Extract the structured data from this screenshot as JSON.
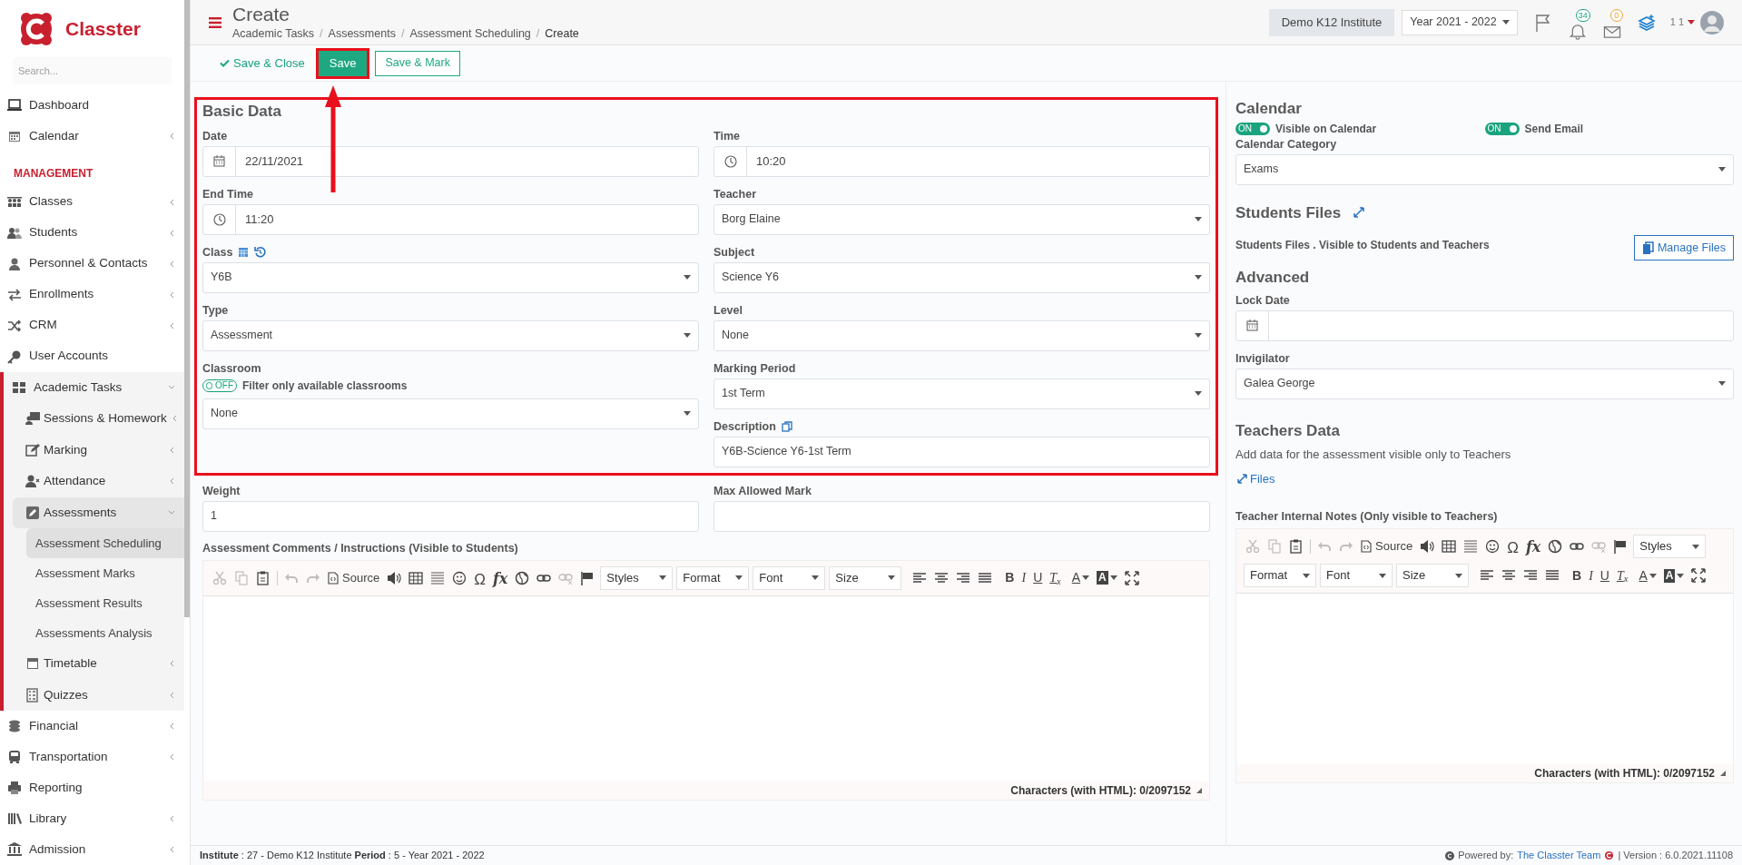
{
  "sidebar": {
    "brand": "Classter",
    "search": {
      "placeholder": "Search..."
    },
    "items": [
      {
        "kind": "link",
        "label": "Dashboard",
        "selected": false
      },
      {
        "kind": "group",
        "label": "Calendar",
        "expanded": false,
        "selected": false
      },
      {
        "kind": "heading",
        "label": "MANAGEMENT"
      },
      {
        "kind": "group",
        "label": "Classes",
        "expanded": false,
        "selected": false
      },
      {
        "kind": "group",
        "label": "Students",
        "expanded": false,
        "selected": false
      },
      {
        "kind": "group",
        "label": "Personnel & Contacts",
        "expanded": false,
        "selected": false
      },
      {
        "kind": "group",
        "label": "Enrollments",
        "expanded": false,
        "selected": false
      },
      {
        "kind": "group",
        "label": "CRM",
        "expanded": false,
        "selected": false
      },
      {
        "kind": "link",
        "label": "User Accounts",
        "selected": false
      },
      {
        "kind": "group",
        "label": "Academic Tasks",
        "expanded": true,
        "selected": false,
        "children": [
          {
            "kind": "group",
            "label": "Sessions & Homework",
            "expanded": false,
            "selected": false
          },
          {
            "kind": "group",
            "label": "Marking",
            "expanded": false,
            "selected": false
          },
          {
            "kind": "group",
            "label": "Attendance",
            "expanded": false,
            "selected": false
          },
          {
            "kind": "group",
            "label": "Assessments",
            "expanded": true,
            "selected": false,
            "children": [
              {
                "label": "Assessment Scheduling",
                "selected": true
              },
              {
                "label": "Assessment Marks",
                "selected": false
              },
              {
                "label": "Assessment Results",
                "selected": false
              },
              {
                "label": "Assessments Analysis",
                "selected": false
              }
            ]
          },
          {
            "kind": "group",
            "label": "Timetable",
            "expanded": false,
            "selected": false
          },
          {
            "kind": "group",
            "label": "Quizzes",
            "expanded": false,
            "selected": false
          }
        ]
      },
      {
        "kind": "group",
        "label": "Financial",
        "expanded": false,
        "selected": false
      },
      {
        "kind": "group",
        "label": "Transportation",
        "expanded": false,
        "selected": false
      },
      {
        "kind": "link",
        "label": "Reporting",
        "selected": false
      },
      {
        "kind": "group",
        "label": "Library",
        "expanded": false,
        "selected": false
      },
      {
        "kind": "group",
        "label": "Admission",
        "expanded": false,
        "selected": false
      }
    ]
  },
  "header": {
    "title": "Create",
    "breadcrumbs": [
      {
        "kind": "link",
        "label": "Academic Tasks"
      },
      {
        "kind": "separator",
        "label": "/"
      },
      {
        "kind": "link",
        "label": "Assessments"
      },
      {
        "kind": "separator",
        "label": "/"
      },
      {
        "kind": "link",
        "label": "Assessment Scheduling"
      },
      {
        "kind": "separator",
        "label": "/"
      },
      {
        "kind": "current",
        "label": "Create"
      }
    ],
    "institute": "Demo K12 Institute",
    "year": "Year 2021 - 2022",
    "notifications": "34",
    "messages": "0",
    "user": "1 1"
  },
  "toolbar": [
    {
      "kind": "link",
      "label": "Save & Close",
      "highlighted": false
    },
    {
      "kind": "primary",
      "label": "Save",
      "highlighted": true
    },
    {
      "kind": "outline",
      "label": "Save & Mark",
      "highlighted": false
    }
  ],
  "basic_data": {
    "title": "Basic Data",
    "highlighted": true,
    "left": [
      {
        "kind": "date",
        "label": "Date",
        "value": "22/11/2021"
      },
      {
        "kind": "time",
        "label": "End Time",
        "value": "11:20"
      },
      {
        "kind": "select",
        "label": "Class",
        "value": "Y6B",
        "tools": true
      },
      {
        "kind": "select",
        "label": "Type",
        "value": "Assessment"
      },
      {
        "kind": "select",
        "label": "Classroom",
        "value": "None",
        "toggle": {
          "on": false,
          "state_text": "OFF",
          "label": "Filter only available classrooms"
        }
      }
    ],
    "right": [
      {
        "kind": "time",
        "label": "Time",
        "value": "10:20"
      },
      {
        "kind": "select",
        "label": "Teacher",
        "value": "Borg Elaine"
      },
      {
        "kind": "select",
        "label": "Subject",
        "value": "Science Y6"
      },
      {
        "kind": "select",
        "label": "Level",
        "value": "None"
      },
      {
        "kind": "select",
        "label": "Marking Period",
        "value": "1st Term"
      },
      {
        "kind": "text",
        "label": "Description",
        "value": "Y6B-Science Y6-1st Term",
        "copy": true
      }
    ]
  },
  "extra_fields": [
    {
      "kind": "text",
      "label": "Weight",
      "value": "1"
    },
    {
      "kind": "text",
      "label": "Max Allowed Mark"
    }
  ],
  "comments_editor": {
    "label": "Assessment Comments / Instructions (Visible to Students)",
    "toolbar": {
      "source": "Source",
      "omega": "Ω",
      "fx": "fx",
      "dropdowns": [
        "Styles",
        "Format",
        "Font",
        "Size"
      ],
      "bold": "B",
      "italic": "I",
      "underline": "U",
      "clear": "T$_{x}$",
      "text_color": "A",
      "bg_color": "A"
    },
    "counter": "Characters (with HTML): 0/2097152"
  },
  "calendar": {
    "title": "Calendar",
    "toggles": [
      {
        "on": true,
        "state_text": "ON",
        "label": "Visible on Calendar"
      },
      {
        "on": true,
        "state_text": "ON",
        "label": "Send Email"
      }
    ],
    "category": {
      "kind": "select",
      "label": "Calendar Category",
      "value": "Exams"
    }
  },
  "students_files": {
    "title": "Students Files",
    "text": "Students Files . Visible to Students and Teachers",
    "button": "Manage Files"
  },
  "advanced": {
    "title": "Advanced",
    "fields": [
      {
        "kind": "date",
        "label": "Lock Date"
      },
      {
        "kind": "select",
        "label": "Invigilator",
        "value": "Galea George"
      }
    ]
  },
  "teachers_data": {
    "title": "Teachers Data",
    "text": "Add data for the assessment visible only to Teachers",
    "files_link": "Files",
    "notes_editor": {
      "label": "Teacher Internal Notes (Only visible to Teachers)",
      "toolbar": {
        "source": "Source",
        "omega": "Ω",
        "fx": "fx",
        "dropdowns": [
          "Styles",
          "Format",
          "Font",
          "Size"
        ],
        "bold": "B",
        "italic": "I",
        "underline": "U",
        "clear": "T$_{x}$",
        "text_color": "A",
        "bg_color": "A"
      },
      "counter": "Characters (with HTML): 0/2097152"
    }
  },
  "footer": {
    "info": "**Institute** : 27 - Demo K12 Institute **Period** : 5 - Year 2021 - 2022",
    "powered_by": "Powered by:",
    "team_link": "The Classter Team",
    "version": "| Version : 6.0.2021.11108"
  }
}
